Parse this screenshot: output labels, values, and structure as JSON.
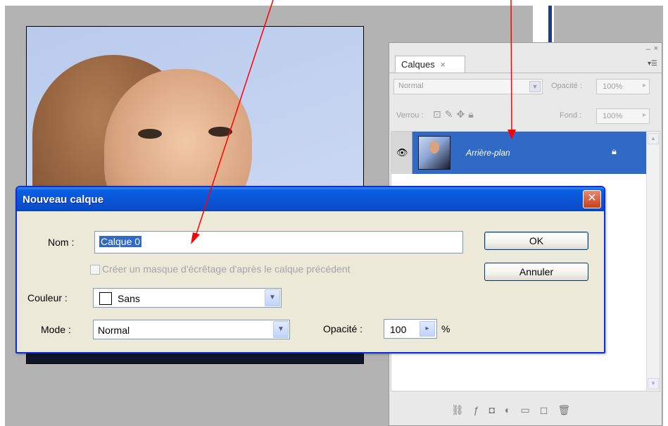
{
  "layers_panel": {
    "minimize": "–",
    "close": "×",
    "tab_label": "Calques",
    "tab_close": "×",
    "menu_icon": "▾☰",
    "blend_mode": "Normal",
    "opacity_label": "Opacité :",
    "opacity_value": "100%",
    "lock_label": "Verrou :",
    "fill_label": "Fond :",
    "fill_value": "100%",
    "layer": {
      "name": "Arrière-plan",
      "visible_icon": "eye-icon",
      "lock_icon": "lock-icon"
    }
  },
  "dialog": {
    "title": "Nouveau calque",
    "name_label": "Nom :",
    "name_value": "Calque 0",
    "clip_label": "Créer un masque d'écrêtage d'après le calque précédent",
    "color_label": "Couleur :",
    "color_value": "Sans",
    "mode_label": "Mode :",
    "mode_value": "Normal",
    "opacity_label": "Opacité :",
    "opacity_value": "100",
    "opacity_unit": "%",
    "ok_label": "OK",
    "cancel_label": "Annuler"
  },
  "colors": {
    "xp_title_blue": "#0a5fe3",
    "selection_blue": "#3169c6",
    "annotation_red": "#ff0000",
    "dialog_bg": "#ece9d8"
  }
}
